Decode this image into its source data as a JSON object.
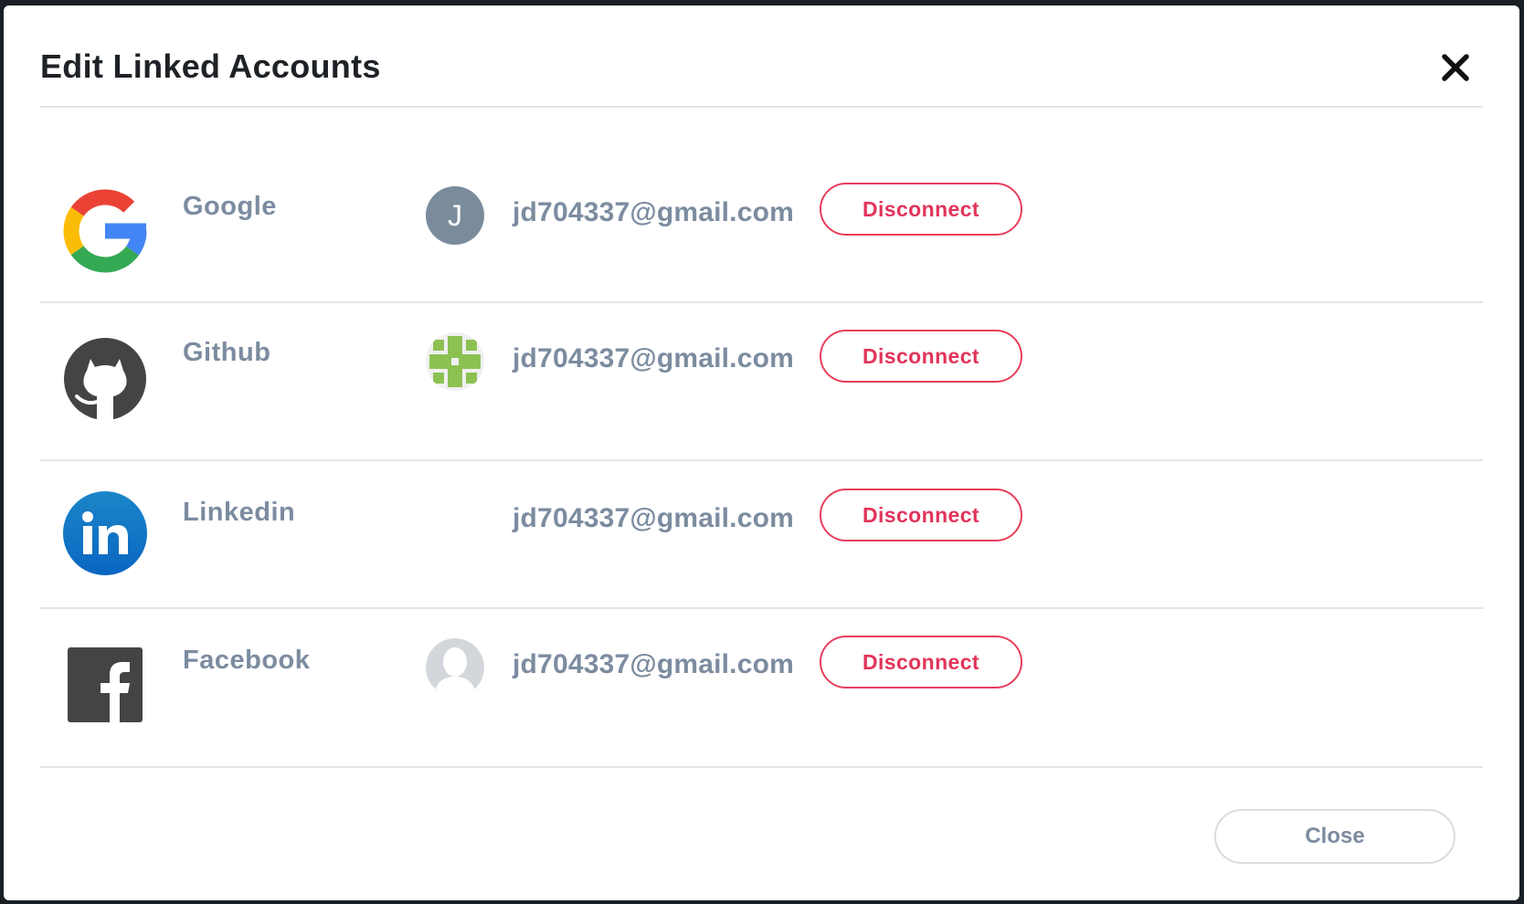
{
  "modal": {
    "title": "Edit Linked Accounts",
    "close_icon": "close-icon",
    "footer_close_label": "Close"
  },
  "accounts": [
    {
      "provider": "Google",
      "provider_icon": "google-logo-icon",
      "avatar_type": "letter",
      "avatar_letter": "J",
      "avatar_color": "#7a8c9c",
      "email": "jd704337@gmail.com",
      "action_label": "Disconnect"
    },
    {
      "provider": "Github",
      "provider_icon": "github-logo-icon",
      "avatar_type": "identicon",
      "avatar_color": "#8cc152",
      "email": "jd704337@gmail.com",
      "action_label": "Disconnect"
    },
    {
      "provider": "Linkedin",
      "provider_icon": "linkedin-logo-icon",
      "avatar_type": "none",
      "email": "jd704337@gmail.com",
      "action_label": "Disconnect"
    },
    {
      "provider": "Facebook",
      "provider_icon": "facebook-logo-icon",
      "avatar_type": "placeholder",
      "avatar_color": "#d3d6da",
      "email": "jd704337@gmail.com",
      "action_label": "Disconnect"
    }
  ],
  "colors": {
    "danger": "#e2345a",
    "muted_text": "#7c8ca0",
    "title_text": "#1e2226",
    "divider": "#e1e4e8",
    "linkedin_blue": "#0a66c2",
    "github_dark": "#444444",
    "facebook_dark": "#444444"
  }
}
